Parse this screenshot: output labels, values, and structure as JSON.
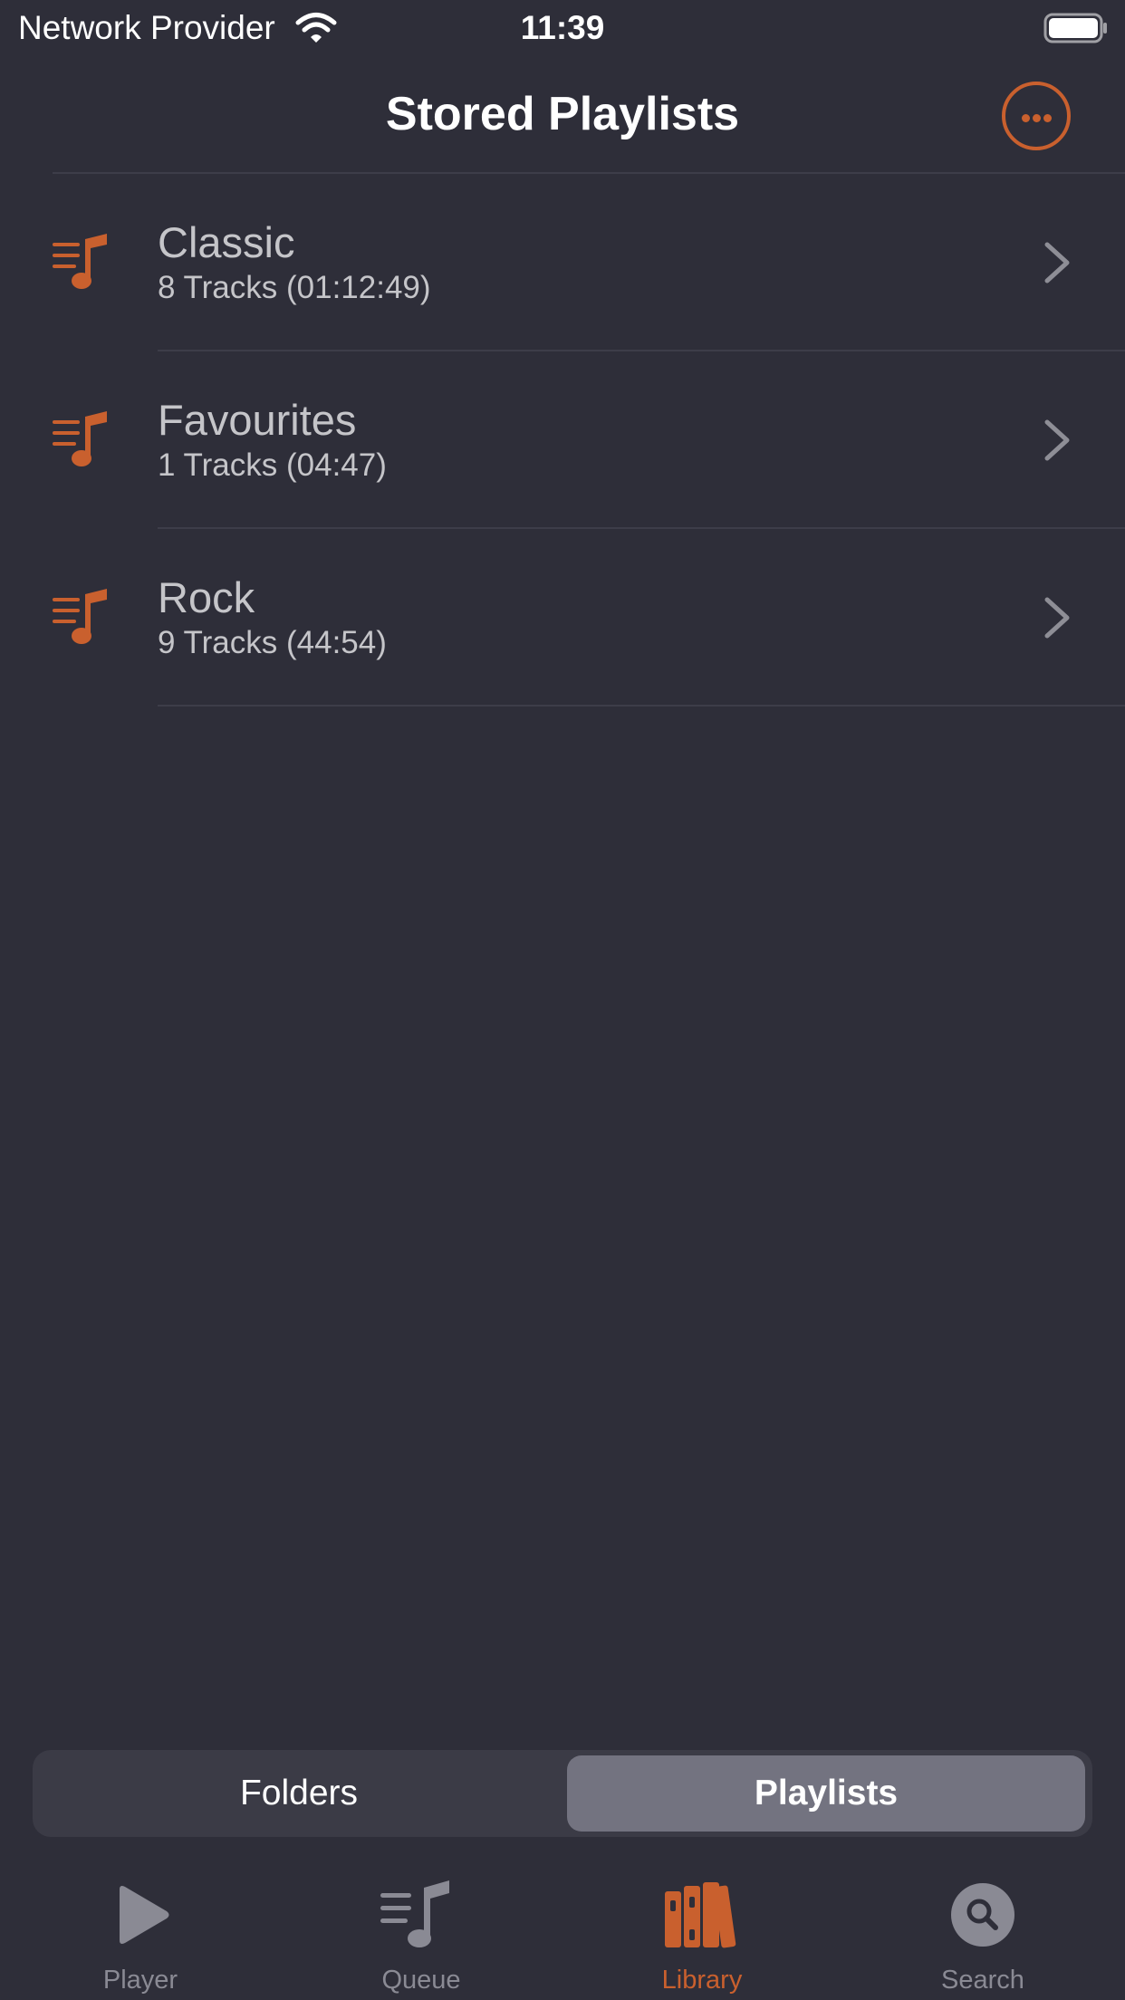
{
  "status_bar": {
    "carrier": "Network Provider",
    "time": "11:39",
    "wifi_icon": "wifi-icon",
    "battery_icon": "battery-full-icon"
  },
  "nav": {
    "title": "Stored Playlists",
    "more_icon": "ellipsis-circle-icon"
  },
  "playlists": [
    {
      "title": "Classic",
      "subtitle": "8 Tracks (01:12:49)",
      "icon": "playlist-music-icon"
    },
    {
      "title": "Favourites",
      "subtitle": "1 Tracks (04:47)",
      "icon": "playlist-music-icon"
    },
    {
      "title": "Rock",
      "subtitle": "9 Tracks (44:54)",
      "icon": "playlist-music-icon"
    }
  ],
  "segmented": {
    "folders": "Folders",
    "playlists": "Playlists",
    "selected": "Playlists"
  },
  "tabs": [
    {
      "label": "Player",
      "icon": "play-icon",
      "active": false
    },
    {
      "label": "Queue",
      "icon": "queue-icon",
      "active": false
    },
    {
      "label": "Library",
      "icon": "library-books-icon",
      "active": true
    },
    {
      "label": "Search",
      "icon": "search-icon",
      "active": false
    }
  ],
  "colors": {
    "background": "#2e2e39",
    "accent": "#c9602e",
    "text_primary": "#ffffff",
    "text_secondary": "#c5c5c9",
    "tab_inactive": "#8a8a94",
    "segment_selected": "#737380"
  }
}
